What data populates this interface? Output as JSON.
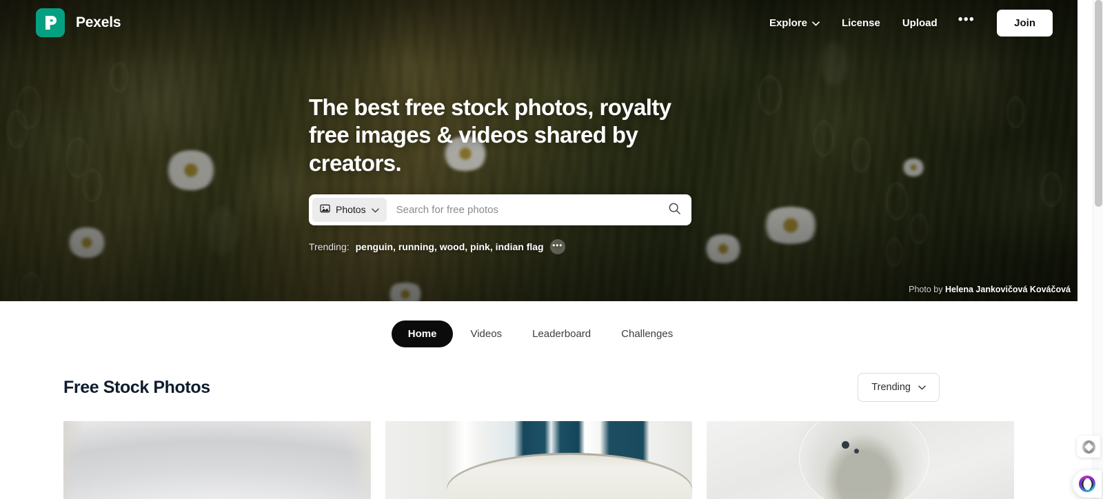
{
  "brand": {
    "name": "Pexels",
    "logo_icon": "pexels-p-logo-icon",
    "accent_color": "#05a081"
  },
  "topnav": {
    "links": [
      {
        "label": "Explore",
        "icon": "chevron-down-icon",
        "has_chevron": true
      },
      {
        "label": "License",
        "has_chevron": false
      },
      {
        "label": "Upload",
        "has_chevron": false
      }
    ],
    "more_label": "•••",
    "more_icon": "ellipsis-icon",
    "join_label": "Join"
  },
  "hero": {
    "title": "The best free stock photos, royalty free images & videos shared by creators.",
    "search": {
      "type_label": "Photos",
      "type_icon": "image-icon",
      "type_chevron_icon": "chevron-down-icon",
      "placeholder": "Search for free photos",
      "value": "",
      "submit_icon": "search-icon"
    },
    "trending": {
      "label": "Trending:",
      "keywords": "penguin, running, wood, pink, indian flag",
      "more_icon": "ellipsis-icon",
      "more_label": "•••"
    },
    "credit_prefix": "Photo by",
    "credit_author": "Helena Jankovičová Kováčová"
  },
  "tabs": [
    {
      "label": "Home",
      "active": true
    },
    {
      "label": "Videos",
      "active": false
    },
    {
      "label": "Leaderboard",
      "active": false
    },
    {
      "label": "Challenges",
      "active": false
    }
  ],
  "section": {
    "title": "Free Stock Photos",
    "sort_label": "Trending",
    "sort_chevron_icon": "chevron-down-icon"
  },
  "grid": [
    {
      "alt": "white ceramic bowl close up"
    },
    {
      "alt": "white building balcony with columns and blue windows"
    },
    {
      "alt": "glass bowl with blueberries on marble surface"
    }
  ],
  "widgets": {
    "badge_icon": "ring-badge-icon",
    "chat_icon": "chat-orb-icon"
  }
}
